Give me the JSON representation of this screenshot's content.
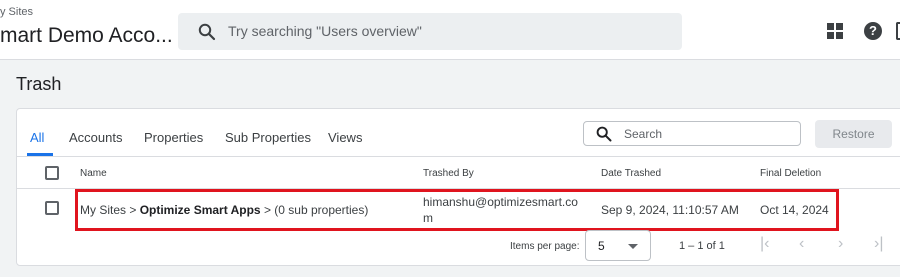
{
  "header": {
    "breadcrumb": "y Sites",
    "account_name": "mart Demo Acco...",
    "search_placeholder": "Try searching \"Users overview\""
  },
  "page": {
    "title": "Trash"
  },
  "tabs": [
    {
      "label": "All",
      "active": true
    },
    {
      "label": "Accounts"
    },
    {
      "label": "Properties"
    },
    {
      "label": "Sub Properties"
    },
    {
      "label": "Views"
    }
  ],
  "search": {
    "placeholder": "Search"
  },
  "restore_label": "Restore",
  "table": {
    "headers": [
      "Name",
      "Trashed By",
      "Date Trashed",
      "Final Deletion"
    ],
    "rows": [
      {
        "name_prefix": "My Sites > ",
        "name_bold": "Optimize Smart Apps",
        "name_suffix": " > (0 sub properties)",
        "trashed_by": "himanshu@optimizesmart.com",
        "date_trashed": "Sep 9, 2024, 11:10:57 AM",
        "final_deletion": "Oct 14, 2024"
      }
    ]
  },
  "pagination": {
    "items_per_page_label": "Items per page:",
    "items_per_page": "5",
    "range": "1 – 1 of 1"
  },
  "colors": {
    "accent": "#1a73e8",
    "highlight": "#e0141e"
  }
}
